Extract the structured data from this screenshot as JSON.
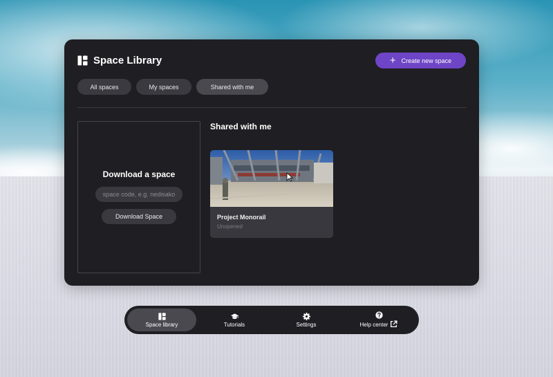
{
  "panel": {
    "title": "Space Library",
    "title_icon": "library-layout-icon",
    "create_button": {
      "label": "Create new space",
      "icon": "plus-icon",
      "color": "#6e45c6"
    },
    "filters": [
      {
        "label": "All spaces",
        "selected": false
      },
      {
        "label": "My spaces",
        "selected": false
      },
      {
        "label": "Shared with me",
        "selected": true
      }
    ],
    "download": {
      "title": "Download a space",
      "input_value": "",
      "input_placeholder": "space code, e.g. nedisako",
      "button_label": "Download Space"
    },
    "section_title": "Shared with me",
    "spaces": [
      {
        "name": "Project Monorail",
        "status": "Unopened"
      }
    ]
  },
  "navbar": {
    "items": [
      {
        "label": "Space library",
        "icon": "library-layout-icon",
        "active": true
      },
      {
        "label": "Tutorials",
        "icon": "graduation-cap-icon",
        "active": false
      },
      {
        "label": "Settings",
        "icon": "gear-icon",
        "active": false
      },
      {
        "label": "Help center",
        "icon": "question-circle-icon",
        "active": false,
        "external_icon": "external-link-icon"
      }
    ]
  }
}
